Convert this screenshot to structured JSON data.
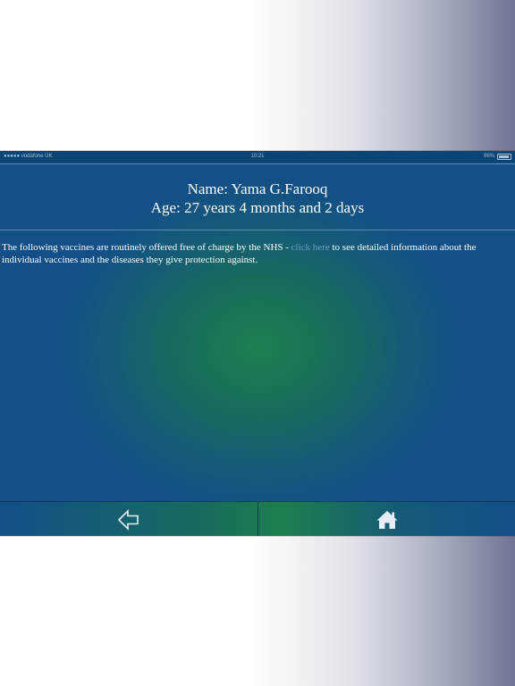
{
  "status_bar": {
    "carrier": "●●●●● vodafone UK",
    "time": "10:21",
    "battery": "96%"
  },
  "header": {
    "name_line": "Name: Yama G.Farooq",
    "age_line": "Age: 27 years 4 months and 2 days"
  },
  "intro": {
    "text_before": "The following vaccines are routinely offered free of charge by the NHS - ",
    "link_text": "click here",
    "text_after": " to see detailed information about the individual vaccines and the diseases they give protection against."
  },
  "nav": {
    "back_icon": "back-arrow-icon",
    "home_icon": "home-icon"
  },
  "colors": {
    "link": "#6b9cc9",
    "text": "#ffffff",
    "bg_center": "#1e7e4e",
    "bg_edge": "#124e88"
  }
}
